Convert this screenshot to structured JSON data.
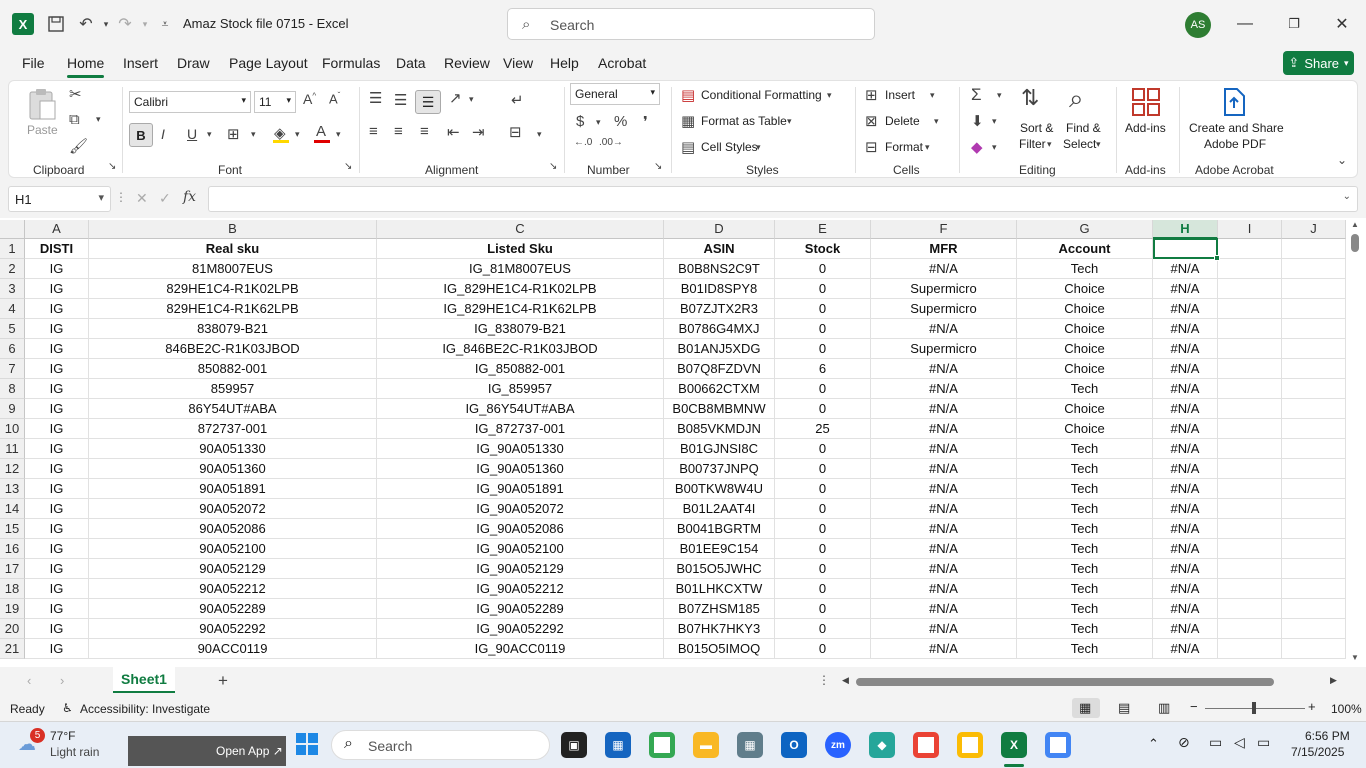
{
  "titlebar": {
    "doc_title": "Amaz Stock file 0715  -  Excel",
    "search_placeholder": "Search",
    "avatar_initials": "AS"
  },
  "menu": {
    "tabs": [
      "File",
      "Home",
      "Insert",
      "Draw",
      "Page Layout",
      "Formulas",
      "Data",
      "Review",
      "View",
      "Help",
      "Acrobat"
    ],
    "active": "Home",
    "share_label": "Share"
  },
  "ribbon": {
    "clipboard": {
      "label": "Clipboard",
      "paste": "Paste"
    },
    "font": {
      "label": "Font",
      "name": "Calibri",
      "size": "11"
    },
    "alignment": {
      "label": "Alignment"
    },
    "number": {
      "label": "Number",
      "format": "General"
    },
    "styles": {
      "label": "Styles",
      "conditional": "Conditional Formatting",
      "format_table": "Format as Table",
      "cell_styles": "Cell Styles"
    },
    "cells": {
      "label": "Cells",
      "insert": "Insert",
      "delete": "Delete",
      "format": "Format"
    },
    "editing": {
      "label": "Editing",
      "sort_filter": "Sort &",
      "sort_filter2": "Filter",
      "find_select": "Find &",
      "find_select2": "Select"
    },
    "addins": {
      "label": "Add-ins",
      "button": "Add-ins"
    },
    "acrobat": {
      "label": "Adobe Acrobat",
      "button1": "Create and Share",
      "button2": "Adobe PDF"
    }
  },
  "formula_bar": {
    "name_box": "H1",
    "formula": ""
  },
  "sheet": {
    "columns": [
      "A",
      "B",
      "C",
      "D",
      "E",
      "F",
      "G",
      "H",
      "I",
      "J"
    ],
    "selected_column": "H",
    "rows": [
      [
        "DISTI",
        "Real sku",
        "Listed Sku",
        "ASIN",
        "Stock",
        "MFR",
        "Account",
        "",
        "",
        ""
      ],
      [
        "IG",
        "81M8007EUS",
        "IG_81M8007EUS",
        "B0B8NS2C9T",
        "0",
        "#N/A",
        "Tech",
        "#N/A",
        "",
        ""
      ],
      [
        "IG",
        "829HE1C4-R1K02LPB",
        "IG_829HE1C4-R1K02LPB",
        "B01ID8SPY8",
        "0",
        "Supermicro",
        "Choice",
        "#N/A",
        "",
        ""
      ],
      [
        "IG",
        "829HE1C4-R1K62LPB",
        "IG_829HE1C4-R1K62LPB",
        "B07ZJTX2R3",
        "0",
        "Supermicro",
        "Choice",
        "#N/A",
        "",
        ""
      ],
      [
        "IG",
        "838079-B21",
        "IG_838079-B21",
        "B0786G4MXJ",
        "0",
        "#N/A",
        "Choice",
        "#N/A",
        "",
        ""
      ],
      [
        "IG",
        "846BE2C-R1K03JBOD",
        "IG_846BE2C-R1K03JBOD",
        "B01ANJ5XDG",
        "0",
        "Supermicro",
        "Choice",
        "#N/A",
        "",
        ""
      ],
      [
        "IG",
        "850882-001",
        "IG_850882-001",
        "B07Q8FZDVN",
        "6",
        "#N/A",
        "Choice",
        "#N/A",
        "",
        ""
      ],
      [
        "IG",
        "859957",
        "IG_859957",
        "B00662CTXM",
        "0",
        "#N/A",
        "Tech",
        "#N/A",
        "",
        ""
      ],
      [
        "IG",
        "86Y54UT#ABA",
        "IG_86Y54UT#ABA",
        "B0CB8MBMNW",
        "0",
        "#N/A",
        "Choice",
        "#N/A",
        "",
        ""
      ],
      [
        "IG",
        "872737-001",
        "IG_872737-001",
        "B085VKMDJN",
        "25",
        "#N/A",
        "Choice",
        "#N/A",
        "",
        ""
      ],
      [
        "IG",
        "90A051330",
        "IG_90A051330",
        "B01GJNSI8C",
        "0",
        "#N/A",
        "Tech",
        "#N/A",
        "",
        ""
      ],
      [
        "IG",
        "90A051360",
        "IG_90A051360",
        "B00737JNPQ",
        "0",
        "#N/A",
        "Tech",
        "#N/A",
        "",
        ""
      ],
      [
        "IG",
        "90A051891",
        "IG_90A051891",
        "B00TKW8W4U",
        "0",
        "#N/A",
        "Tech",
        "#N/A",
        "",
        ""
      ],
      [
        "IG",
        "90A052072",
        "IG_90A052072",
        "B01L2AAT4I",
        "0",
        "#N/A",
        "Tech",
        "#N/A",
        "",
        ""
      ],
      [
        "IG",
        "90A052086",
        "IG_90A052086",
        "B0041BGRTM",
        "0",
        "#N/A",
        "Tech",
        "#N/A",
        "",
        ""
      ],
      [
        "IG",
        "90A052100",
        "IG_90A052100",
        "B01EE9C154",
        "0",
        "#N/A",
        "Tech",
        "#N/A",
        "",
        ""
      ],
      [
        "IG",
        "90A052129",
        "IG_90A052129",
        "B015O5JWHC",
        "0",
        "#N/A",
        "Tech",
        "#N/A",
        "",
        ""
      ],
      [
        "IG",
        "90A052212",
        "IG_90A052212",
        "B01LHKCXTW",
        "0",
        "#N/A",
        "Tech",
        "#N/A",
        "",
        ""
      ],
      [
        "IG",
        "90A052289",
        "IG_90A052289",
        "B07ZHSM185",
        "0",
        "#N/A",
        "Tech",
        "#N/A",
        "",
        ""
      ],
      [
        "IG",
        "90A052292",
        "IG_90A052292",
        "B07HK7HKY3",
        "0",
        "#N/A",
        "Tech",
        "#N/A",
        "",
        ""
      ],
      [
        "IG",
        "90ACC0119",
        "IG_90ACC0119",
        "B015O5IMOQ",
        "0",
        "#N/A",
        "Tech",
        "#N/A",
        "",
        ""
      ]
    ]
  },
  "sheet_tabs": {
    "active": "Sheet1",
    "add_label": "+"
  },
  "status": {
    "ready": "Ready",
    "accessibility": "Accessibility: Investigate",
    "zoom": "100%"
  },
  "taskbar": {
    "weather_temp": "77°F",
    "weather_desc": "Light rain",
    "weather_badge": "5",
    "open_app": "Open App ↗",
    "search": "Search",
    "time": "6:56 PM",
    "date": "7/15/2025"
  },
  "colors": {
    "excel_green": "#107c41"
  }
}
